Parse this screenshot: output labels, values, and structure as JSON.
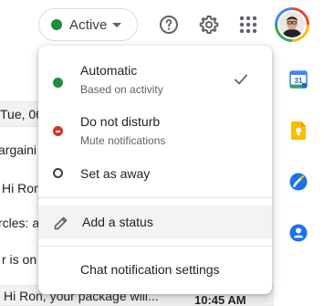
{
  "header": {
    "status_label": "Active",
    "status_color": "#1e8e3e",
    "help_icon": "help-circle-icon",
    "settings_icon": "gear-icon",
    "apps_icon": "apps-grid-icon"
  },
  "background": {
    "rows": [
      "Tue, 06",
      "argaini",
      "Hi Ron,",
      "rcles: a",
      "r is on",
      "Hi Ron, your package will..."
    ],
    "time": "10:45 AM"
  },
  "side_panel": {
    "apps": [
      "calendar-icon",
      "keep-icon",
      "tasks-icon",
      "contacts-icon"
    ]
  },
  "menu": {
    "automatic": {
      "title": "Automatic",
      "subtitle": "Based on activity",
      "selected": true
    },
    "dnd": {
      "title": "Do not disturb",
      "subtitle": "Mute notifications"
    },
    "away": {
      "title": "Set as away"
    },
    "add_status": "Add a status",
    "chat_settings": "Chat notification settings"
  }
}
